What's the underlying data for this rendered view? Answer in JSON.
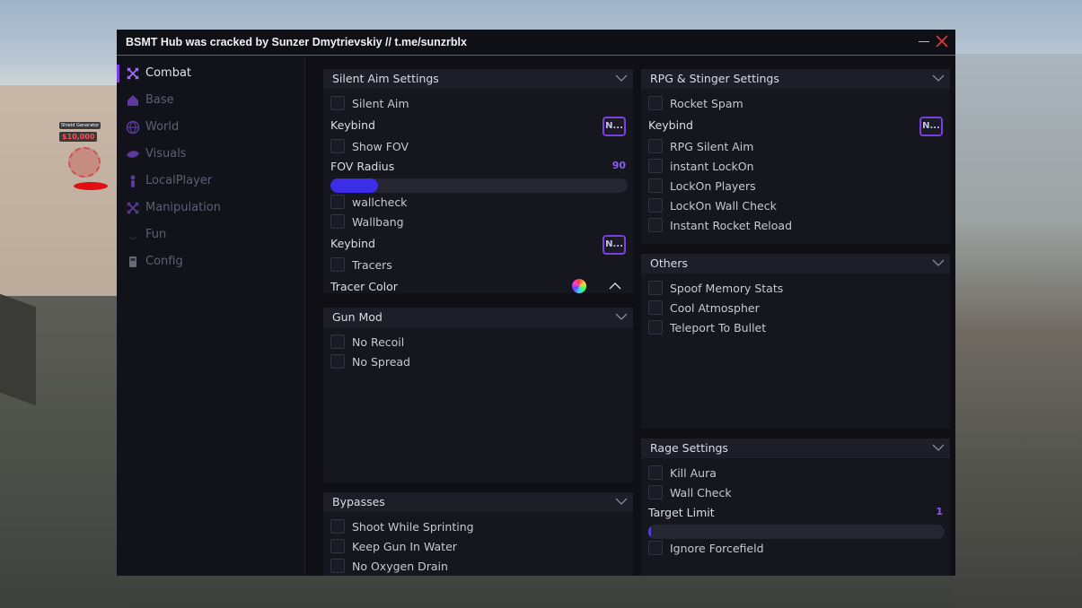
{
  "window": {
    "title": "BSMT Hub was cracked by Sunzer Dmytrievskiy // t.me/sunzrblx",
    "accent_color": "#7b3fe0"
  },
  "scene": {
    "generator_label": "Shield Generator",
    "generator_price": "$10,000"
  },
  "sidebar": {
    "items": [
      {
        "label": "Combat",
        "icon": "crossed-swords-icon",
        "active": true
      },
      {
        "label": "Base",
        "icon": "house-icon",
        "active": false
      },
      {
        "label": "World",
        "icon": "globe-icon",
        "active": false
      },
      {
        "label": "Visuals",
        "icon": "eye-icon",
        "active": false
      },
      {
        "label": "LocalPlayer",
        "icon": "person-icon",
        "active": false
      },
      {
        "label": "Manipulation",
        "icon": "crossed-swords-icon",
        "active": false
      },
      {
        "label": "Fun",
        "icon": "smile-icon",
        "active": false
      },
      {
        "label": "Config",
        "icon": "file-icon",
        "active": false
      }
    ]
  },
  "silent_aim": {
    "title": "Silent Aim Settings",
    "silent_aim": "Silent Aim",
    "keybind1_label": "Keybind",
    "keybind1_value": "N...",
    "show_fov": "Show FOV",
    "fov_radius_label": "FOV Radius",
    "fov_radius_value": "90",
    "fov_radius_fraction": 0.16,
    "wallcheck": "wallcheck",
    "wallbang": "Wallbang",
    "keybind2_label": "Keybind",
    "keybind2_value": "N...",
    "tracers": "Tracers",
    "tracer_color_label": "Tracer Color"
  },
  "gun_mod": {
    "title": "Gun Mod",
    "no_recoil": "No Recoil",
    "no_spread": "No Spread"
  },
  "bypasses": {
    "title": "Bypasses",
    "shoot_while_sprinting": "Shoot While Sprinting",
    "keep_gun_in_water": "Keep Gun In Water",
    "no_oxygen_drain": "No Oxygen Drain"
  },
  "rpg": {
    "title": "RPG & Stinger Settings",
    "rocket_spam": "Rocket Spam",
    "keybind_label": "Keybind",
    "keybind_value": "N...",
    "rpg_silent_aim": "RPG Silent Aim",
    "instant_lockon": "instant LockOn",
    "lockon_players": "LockOn Players",
    "lockon_wall_check": "LockOn Wall Check",
    "instant_rocket_reload": "Instant Rocket Reload"
  },
  "others": {
    "title": "Others",
    "spoof_memory_stats": "Spoof Memory Stats",
    "cool_atmospher": "Cool Atmospher",
    "teleport_to_bullet": "Teleport To Bullet"
  },
  "rage": {
    "title": "Rage Settings",
    "kill_aura": "Kill Aura",
    "wall_check": "Wall Check",
    "target_limit_label": "Target Limit",
    "target_limit_value": "1",
    "target_limit_fraction": 0.0,
    "ignore_forcefield": "Ignore Forcefield"
  }
}
